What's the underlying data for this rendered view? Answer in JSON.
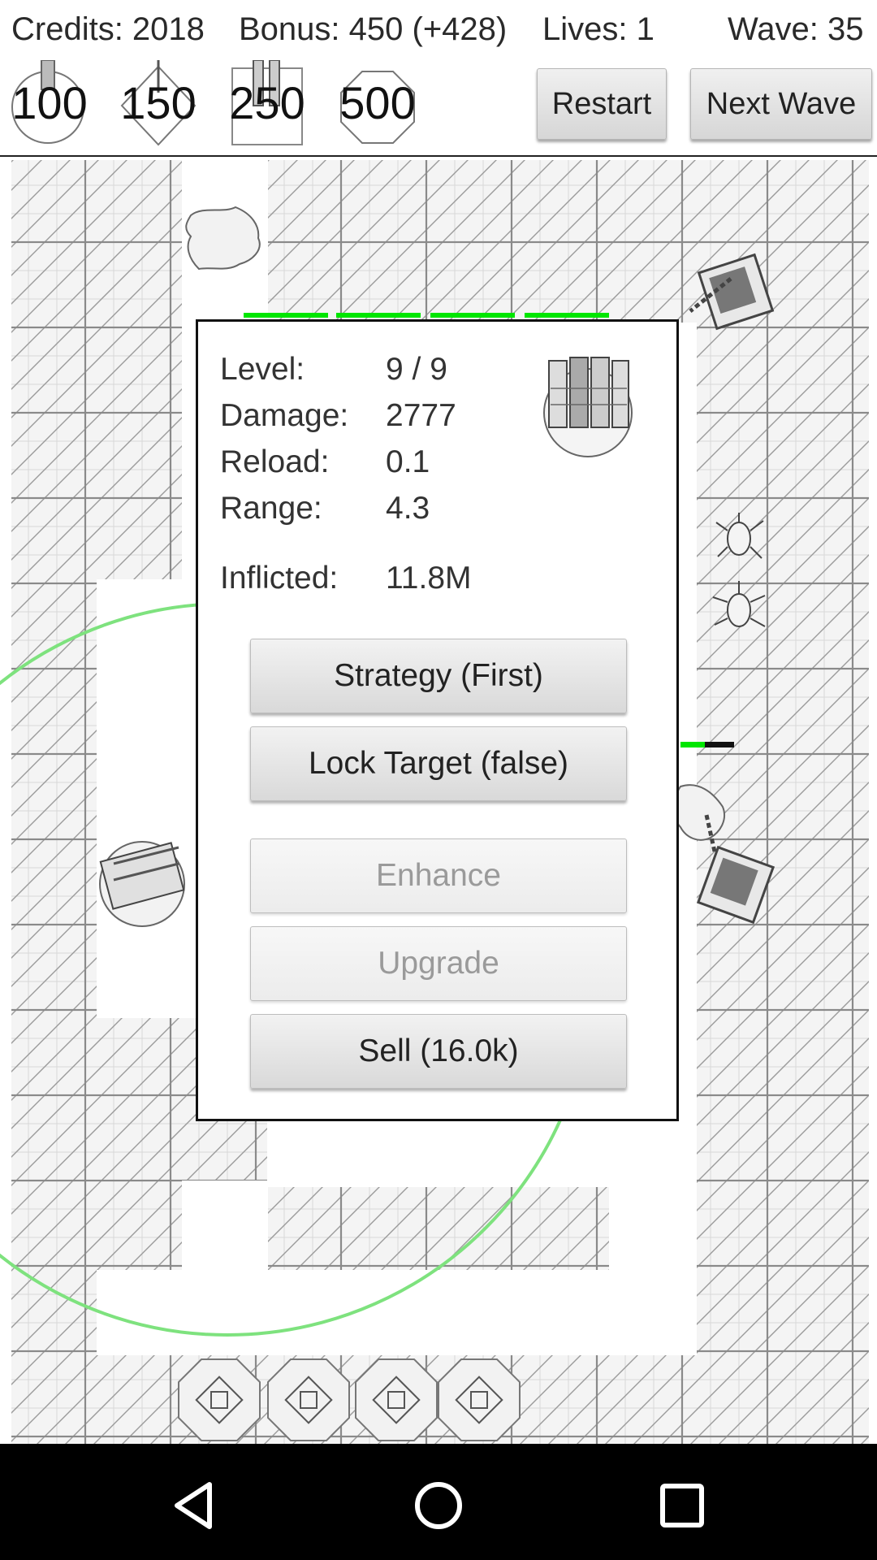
{
  "header": {
    "credits": "Credits: 2018",
    "bonus": "Bonus: 450 (+428)",
    "lives": "Lives: 1",
    "wave": "Wave: 35",
    "restart_label": "Restart",
    "next_wave_label": "Next Wave"
  },
  "shop": [
    {
      "price": "100",
      "icon": "basic-tower-icon"
    },
    {
      "price": "150",
      "icon": "diamond-tower-icon"
    },
    {
      "price": "250",
      "icon": "multi-barrel-tower-icon"
    },
    {
      "price": "500",
      "icon": "octagon-tower-icon"
    }
  ],
  "dialog": {
    "level_label": "Level:",
    "level_value": "9 / 9",
    "damage_label": "Damage:",
    "damage_value": "2777",
    "reload_label": "Reload:",
    "reload_value": "0.1",
    "range_label": "Range:",
    "range_value": "4.3",
    "inflicted_label": "Inflicted:",
    "inflicted_value": "11.8M",
    "strategy_label": "Strategy (First)",
    "lock_target_label": "Lock Target (false)",
    "enhance_label": "Enhance",
    "upgrade_label": "Upgrade",
    "sell_label": "Sell (16.0k)",
    "tower_icon": "multi-barrel-tower-icon"
  },
  "colors": {
    "range_circle": "#7ee27e",
    "health_bar": "#00e600",
    "nav_background": "#000000"
  },
  "navbar": {
    "back": "back-triangle-icon",
    "home": "home-circle-icon",
    "recents": "recents-square-icon"
  }
}
